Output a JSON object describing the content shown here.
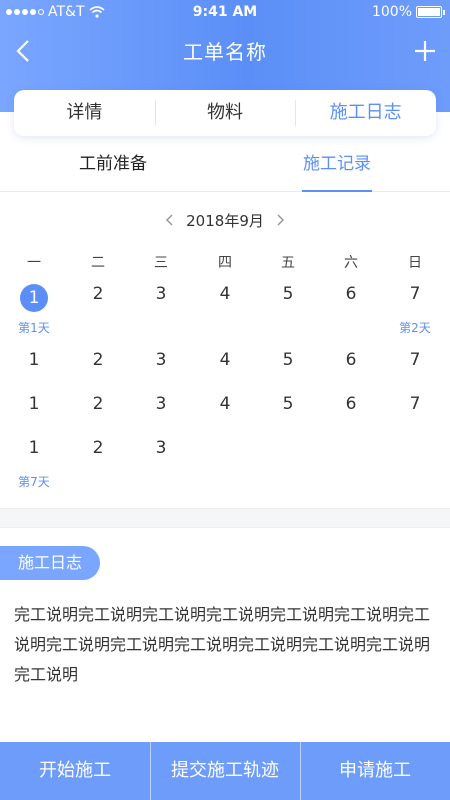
{
  "status_bar": {
    "carrier": "AT&T",
    "time": "9:41 AM",
    "battery": "100%"
  },
  "nav": {
    "title": "工单名称",
    "back_icon": "chevron-left-icon",
    "add_icon": "plus-icon"
  },
  "segment_tabs": [
    {
      "label": "详情",
      "active": false
    },
    {
      "label": "物料",
      "active": false
    },
    {
      "label": "施工日志",
      "active": true
    }
  ],
  "sub_tabs": [
    {
      "label": "工前准备",
      "active": false
    },
    {
      "label": "施工记录",
      "active": true
    }
  ],
  "calendar": {
    "month_label": "2018年9月",
    "weekdays": [
      "一",
      "二",
      "三",
      "四",
      "五",
      "六",
      "日"
    ],
    "rows": [
      [
        "1",
        "2",
        "3",
        "4",
        "5",
        "6",
        "7"
      ],
      [
        "1",
        "2",
        "3",
        "4",
        "5",
        "6",
        "7"
      ],
      [
        "1",
        "2",
        "3",
        "4",
        "5",
        "6",
        "7"
      ],
      [
        "1",
        "2",
        "3"
      ]
    ],
    "selected": {
      "row": 0,
      "col": 0
    },
    "day_tags": [
      {
        "row": 0,
        "col": 0,
        "label": "第1天"
      },
      {
        "row": 0,
        "col": 6,
        "label": "第2天"
      },
      {
        "row": 3,
        "col": 0,
        "label": "第7天"
      }
    ]
  },
  "log": {
    "label": "施工日志",
    "text": "完工说明完工说明完工说明完工说明完工说明完工说明完工说明完工说明完工说明完工说明完工说明完工说明完工说明完工说明"
  },
  "bottom_buttons": [
    {
      "label": "开始施工"
    },
    {
      "label": "提交施工轨迹"
    },
    {
      "label": "申请施工"
    }
  ],
  "colors": {
    "accent": "#5b8ff7",
    "header_start": "#7aa6ff",
    "button_bar": "#6e9cfb"
  }
}
